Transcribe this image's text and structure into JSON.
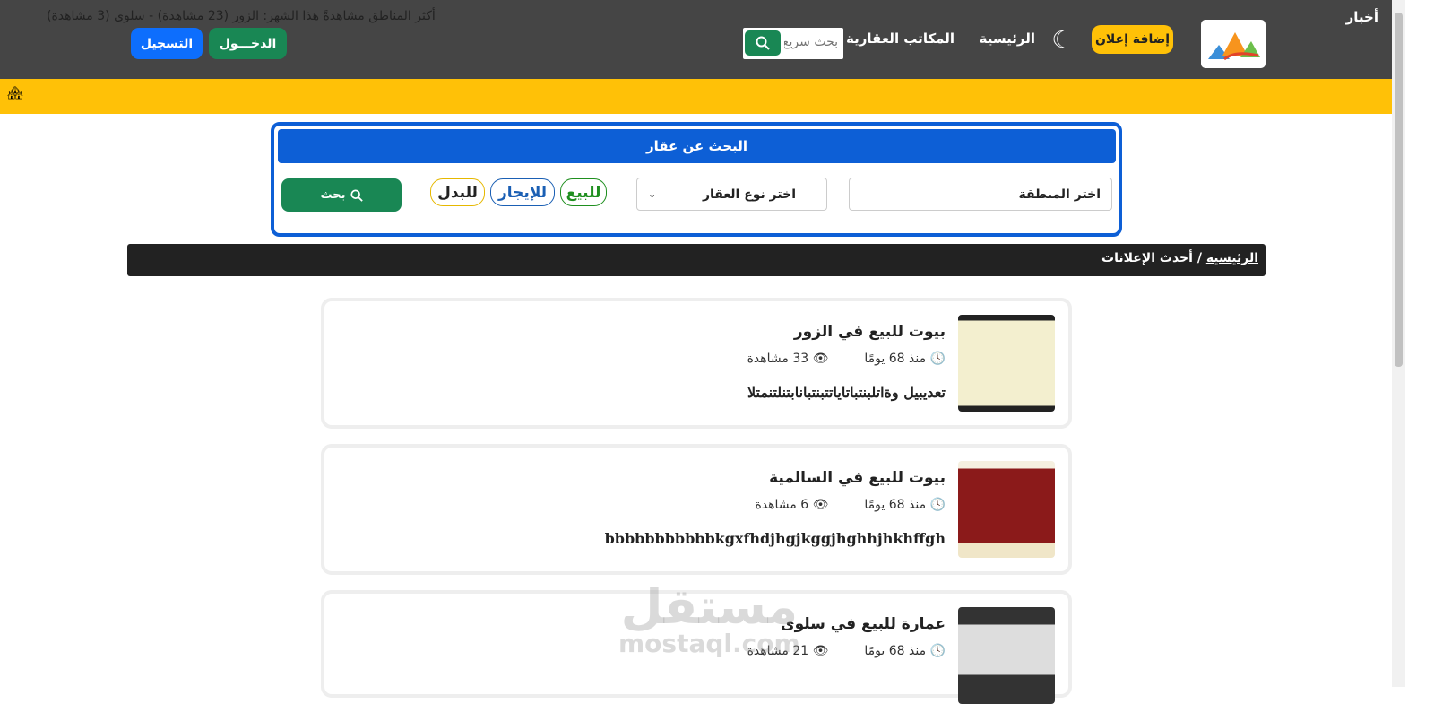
{
  "header": {
    "add_ad": "إضافة إعلان",
    "nav": [
      "الرئيسية",
      "المكاتب العقارية"
    ],
    "search_placeholder": "بحث سريع",
    "login": "الدخـــول",
    "register": "التسجيل"
  },
  "news": {
    "label": "أخبار",
    "text": "أكثر المناطق مشاهدةً هذا الشهر: الزور (23 مشاهدة) - سلوى (3 مشاهدة)"
  },
  "search": {
    "title": "البحث عن عقار",
    "region": "اختر المنطقة",
    "type": "اختر نوع العقار",
    "sale": "للبيع",
    "rent": "للإيجار",
    "swap": "للبدل",
    "go": "بحث"
  },
  "breadcrumb": {
    "home": "الرئيسية",
    "sep": "/",
    "current": "أحدث الإعلانات"
  },
  "listings": [
    {
      "title": "بيوت للبيع في الزور",
      "age": "منذ 68 يومًا",
      "views": "33 مشاهدة",
      "desc": "تعديبيل وةاتلبنتباتاياتتبنتبانابتنلتنمتلا"
    },
    {
      "title": "بيوت للبيع في السالمية",
      "age": "منذ 68 يومًا",
      "views": "6 مشاهدة",
      "desc": "bbbbbbbbbbbkgxfhdjhgjkggjhghhjhkhffgh"
    },
    {
      "title": "عمارة للبيع في سلوى",
      "age": "منذ 68 يومًا",
      "views": "21 مشاهدة",
      "desc": ""
    }
  ],
  "watermark": {
    "ar": "مستقل",
    "en": "mostaql.com"
  }
}
